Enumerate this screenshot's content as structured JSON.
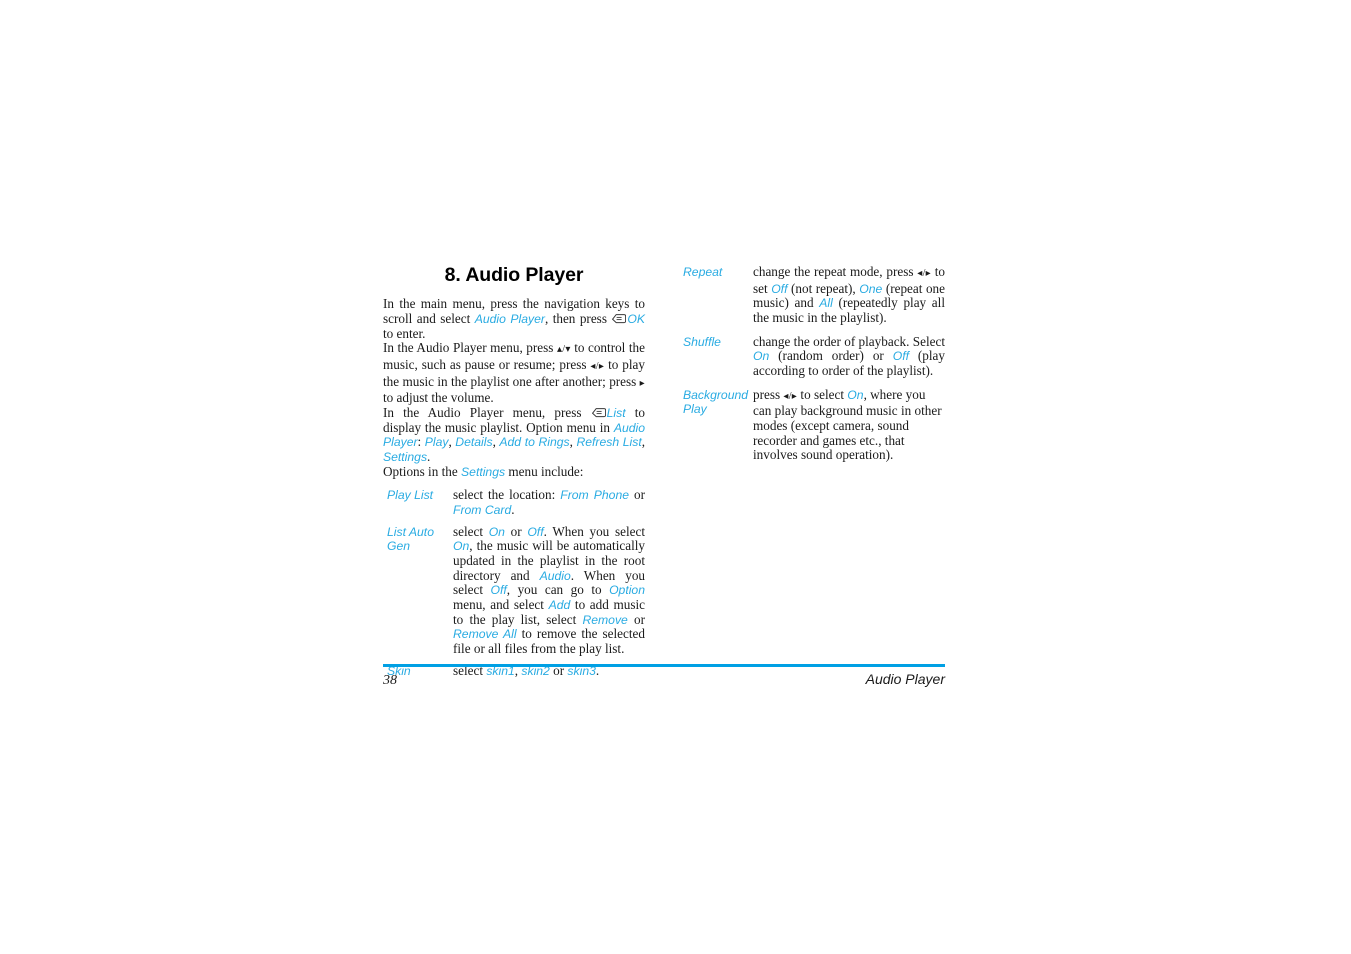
{
  "document": {
    "chapter_number": "8.",
    "chapter_title": "8. Audio Player"
  },
  "left_column": {
    "intro_paragraph_1": {
      "seg1": "In the main menu, press the navigation keys to scroll and select ",
      "term_audio_player": "Audio Player",
      "seg2": ", then press ",
      "softkey_icon": "softkey-icon",
      "term_ok": "OK",
      "seg3": " to enter."
    },
    "intro_paragraph_2": {
      "seg1": "In the Audio Player menu, press ",
      "keys_updown": "▴/▾",
      "seg2": " to control the music, such as pause or resume; press ",
      "keys_leftright": "◂/▸",
      "seg3": " to play the music in the playlist one after another; press ",
      "key_right": "▸",
      "seg4": " to adjust the volume."
    },
    "intro_paragraph_3": {
      "seg1": "In the Audio Player menu, press ",
      "softkey_icon": "softkey-icon",
      "term_list": "List",
      "seg2": " to display the music playlist. Option menu in ",
      "term_audio_player": "Audio Player",
      "seg3": ": ",
      "term_play": "Play",
      "sep1": ", ",
      "term_details": "Details",
      "sep2": ", ",
      "term_add_to_rings": "Add to Rings",
      "sep3": ", ",
      "term_refresh_list": "Refresh List",
      "sep4": ", ",
      "term_settings": "Settings",
      "seg4": "."
    },
    "intro_paragraph_4": {
      "seg1": "Options in the ",
      "term_settings": "Settings",
      "seg2": " menu include:"
    },
    "definitions": [
      {
        "term": "Play List",
        "parts": [
          {
            "t": "text",
            "v": "select the location: "
          },
          {
            "t": "hl",
            "v": "From Phone"
          },
          {
            "t": "text",
            "v": " or "
          },
          {
            "t": "hl",
            "v": "From Card"
          },
          {
            "t": "text",
            "v": "."
          }
        ]
      },
      {
        "term": "List Auto Gen",
        "parts": [
          {
            "t": "text",
            "v": "select "
          },
          {
            "t": "hl",
            "v": "On"
          },
          {
            "t": "text",
            "v": " or "
          },
          {
            "t": "hl",
            "v": "Off"
          },
          {
            "t": "text",
            "v": ". When you select "
          },
          {
            "t": "hl",
            "v": "On"
          },
          {
            "t": "text",
            "v": ", the music will be automatically updated in the playlist in the root directory and "
          },
          {
            "t": "hl",
            "v": "Audio"
          },
          {
            "t": "text",
            "v": ". When you select "
          },
          {
            "t": "hl",
            "v": "Off"
          },
          {
            "t": "text",
            "v": ", you can go to "
          },
          {
            "t": "hl",
            "v": "Option"
          },
          {
            "t": "text",
            "v": " menu, and select "
          },
          {
            "t": "hl",
            "v": "Add"
          },
          {
            "t": "text",
            "v": " to add music to the play list, select "
          },
          {
            "t": "hl",
            "v": "Remove"
          },
          {
            "t": "text",
            "v": " or "
          },
          {
            "t": "hl",
            "v": "Remove All"
          },
          {
            "t": "text",
            "v": " to remove the selected file or all files from the play list."
          }
        ]
      },
      {
        "term": "Skin",
        "parts": [
          {
            "t": "text",
            "v": "select "
          },
          {
            "t": "hl",
            "v": "skin1"
          },
          {
            "t": "text",
            "v": ", "
          },
          {
            "t": "hl",
            "v": "skin2"
          },
          {
            "t": "text",
            "v": " or "
          },
          {
            "t": "hl",
            "v": "skin3"
          },
          {
            "t": "text",
            "v": "."
          }
        ]
      }
    ]
  },
  "right_column": {
    "definitions": [
      {
        "term": "Repeat",
        "parts": [
          {
            "t": "text",
            "v": "change the repeat mode, press "
          },
          {
            "t": "keys",
            "v": "◂/▸"
          },
          {
            "t": "text",
            "v": " to set "
          },
          {
            "t": "hl",
            "v": "Off"
          },
          {
            "t": "text",
            "v": " (not repeat), "
          },
          {
            "t": "hl",
            "v": "One"
          },
          {
            "t": "text",
            "v": " (repeat one music) and "
          },
          {
            "t": "hl",
            "v": "All"
          },
          {
            "t": "text",
            "v": " (repeatedly play all the music in the playlist)."
          }
        ]
      },
      {
        "term": "Shuffle",
        "parts": [
          {
            "t": "text",
            "v": "change the order of playback. Select "
          },
          {
            "t": "hl",
            "v": "On"
          },
          {
            "t": "text",
            "v": " (random order) or "
          },
          {
            "t": "hl",
            "v": "Off"
          },
          {
            "t": "text",
            "v": " (play according to order of the playlist)."
          }
        ]
      },
      {
        "term": "Background Play",
        "parts": [
          {
            "t": "text",
            "v": "press "
          },
          {
            "t": "keys",
            "v": "◂/▸"
          },
          {
            "t": "text",
            "v": " to select "
          },
          {
            "t": "hl",
            "v": "On"
          },
          {
            "t": "text",
            "v": ", where you can play background music in other modes (except camera, sound recorder and games etc., that involves sound operation)."
          }
        ]
      }
    ]
  },
  "footer": {
    "page_number": "38",
    "chapter_name": "Audio Player"
  },
  "colors": {
    "accent_blue": "#29abe2",
    "rule_blue": "#00a0e4",
    "body_text": "#1a1a1a"
  }
}
